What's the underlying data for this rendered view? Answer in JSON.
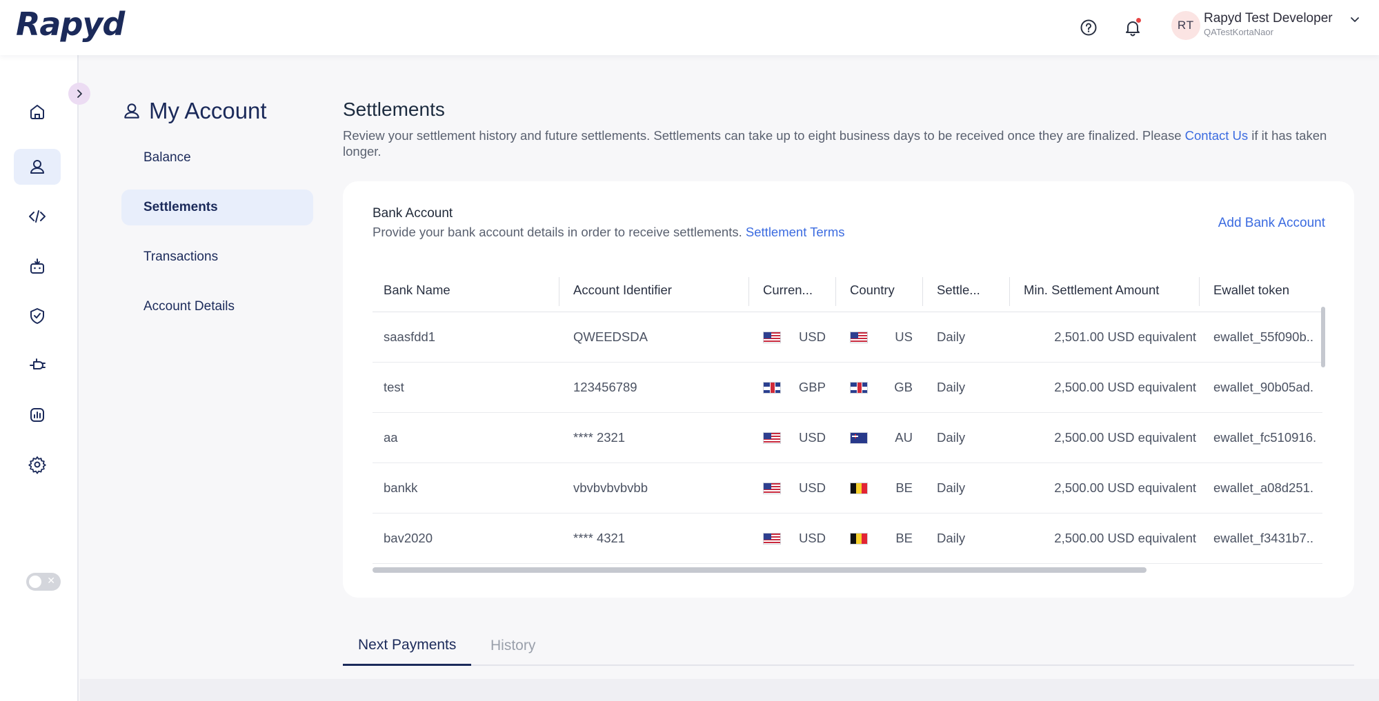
{
  "brand": {
    "logo_text": "Rapyd"
  },
  "topbar": {
    "help_icon": "help-circle-icon",
    "notification_icon": "bell-icon",
    "avatar_initials": "RT",
    "user_name": "Rapyd Test Developer",
    "org_name": "QATestKortaNaor"
  },
  "rail": {
    "items": [
      "home-icon",
      "user-icon",
      "code-icon",
      "robot-icon",
      "shield-check-icon",
      "plug-icon",
      "reports-icon",
      "settings-icon"
    ],
    "active_index": 1
  },
  "subnav": {
    "title": "My Account",
    "items": [
      "Balance",
      "Settlements",
      "Transactions",
      "Account Details"
    ],
    "active_index": 1
  },
  "main": {
    "title": "Settlements",
    "description": "Review your settlement history and future settlements. Settlements can take up to eight business days to be received once they are finalized. Please",
    "contact_link": "Contact Us",
    "description_tail": "if it has taken longer."
  },
  "bank_card": {
    "title": "Bank Account",
    "subtitle": "Provide your bank account details in order to receive settlements.",
    "terms_link": "Settlement Terms",
    "add_button": "Add Bank Account",
    "columns": [
      "Bank Name",
      "Account Identifier",
      "Curren...",
      "Country",
      "Settle...",
      "Min. Settlement Amount",
      "Ewallet token"
    ],
    "rows": [
      {
        "bank": "saasfdd1",
        "identifier": "QWEEDSDA",
        "currency": "USD",
        "currency_flag": "us",
        "country": "US",
        "country_flag": "us",
        "schedule": "Daily",
        "min_amount": "2,501.00 USD equivalent",
        "ewallet": "ewallet_55f090b.."
      },
      {
        "bank": "test",
        "identifier": "123456789",
        "currency": "GBP",
        "currency_flag": "gb",
        "country": "GB",
        "country_flag": "gb",
        "schedule": "Daily",
        "min_amount": "2,500.00 USD equivalent",
        "ewallet": "ewallet_90b05ad."
      },
      {
        "bank": "aa",
        "identifier": "**** 2321",
        "currency": "USD",
        "currency_flag": "us",
        "country": "AU",
        "country_flag": "au",
        "schedule": "Daily",
        "min_amount": "2,500.00 USD equivalent",
        "ewallet": "ewallet_fc510916."
      },
      {
        "bank": "bankk",
        "identifier": "vbvbvbvbvbb",
        "currency": "USD",
        "currency_flag": "us",
        "country": "BE",
        "country_flag": "be",
        "schedule": "Daily",
        "min_amount": "2,500.00 USD equivalent",
        "ewallet": "ewallet_a08d251."
      },
      {
        "bank": "bav2020",
        "identifier": "**** 4321",
        "currency": "USD",
        "currency_flag": "us",
        "country": "BE",
        "country_flag": "be",
        "schedule": "Daily",
        "min_amount": "2,500.00 USD equivalent",
        "ewallet": "ewallet_f3431b7.."
      }
    ]
  },
  "tabs": {
    "items": [
      "Next Payments",
      "History"
    ],
    "active_index": 0
  },
  "colors": {
    "brand_navy": "#1b2a5a",
    "link_blue": "#3b6be0",
    "active_bg": "#e8eefb"
  }
}
